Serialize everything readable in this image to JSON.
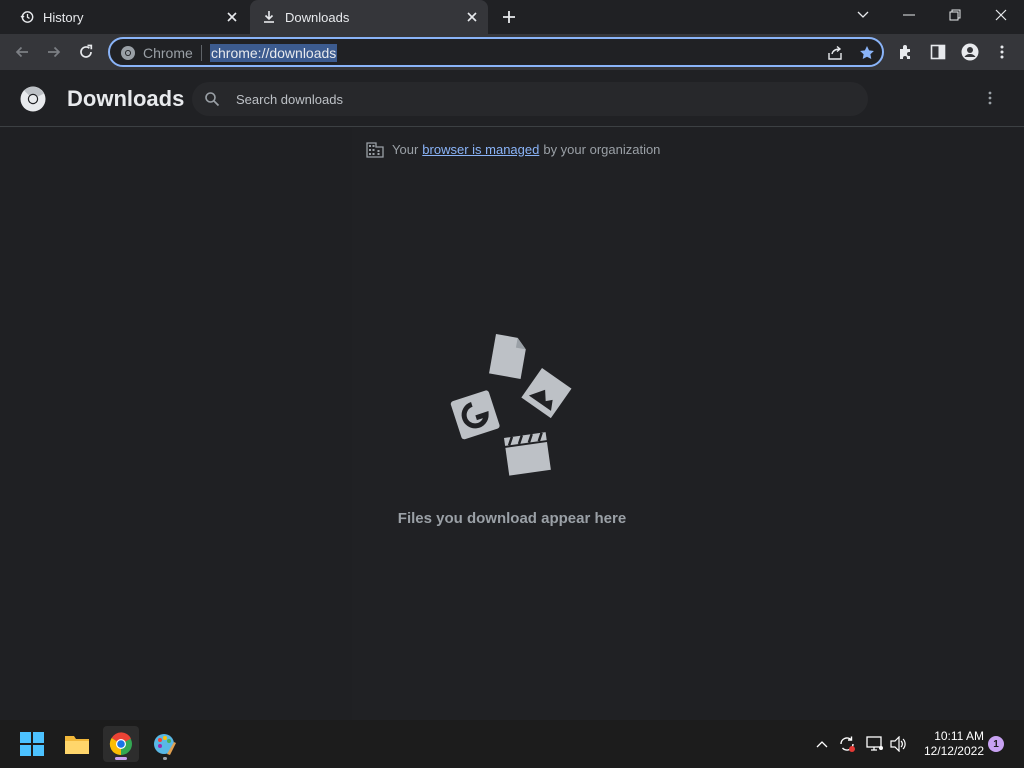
{
  "tabs": [
    {
      "label": "History",
      "icon": "history-icon"
    },
    {
      "label": "Downloads",
      "icon": "download-icon"
    }
  ],
  "omnibox": {
    "chip": "Chrome",
    "url": "chrome://downloads"
  },
  "page": {
    "title": "Downloads",
    "search_placeholder": "Search downloads"
  },
  "managed_notice": {
    "prefix": "Your",
    "link": "browser is managed",
    "suffix": "by your organization"
  },
  "empty_state": {
    "message": "Files you download appear here"
  },
  "taskbar": {
    "time": "10:11 AM",
    "date": "12/12/2022",
    "notification_count": "1"
  },
  "colors": {
    "accent": "#8ab4f8",
    "background": "#202124",
    "toolbar": "#35363a"
  }
}
